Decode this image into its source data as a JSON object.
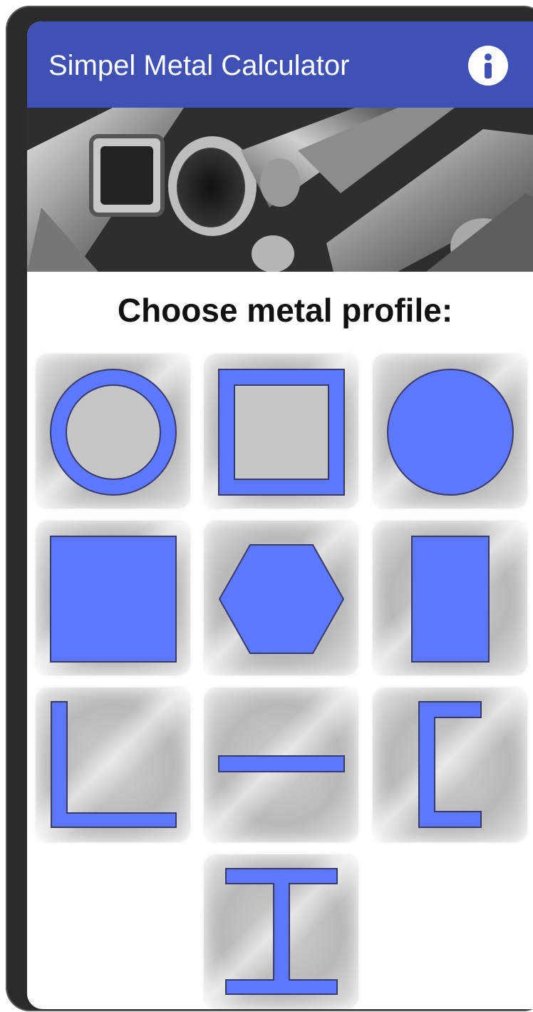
{
  "appbar": {
    "title": "Simpel Metal Calculator",
    "info_icon": "info-icon"
  },
  "hero": {
    "image": "metal-profiles-photo"
  },
  "main": {
    "heading": "Choose metal profile:",
    "profiles": [
      {
        "icon": "round-tube-icon"
      },
      {
        "icon": "square-tube-icon"
      },
      {
        "icon": "round-bar-icon"
      },
      {
        "icon": "square-bar-icon"
      },
      {
        "icon": "hexagon-bar-icon"
      },
      {
        "icon": "flat-bar-icon"
      },
      {
        "icon": "angle-profile-icon"
      },
      {
        "icon": "sheet-icon"
      },
      {
        "icon": "channel-profile-icon"
      },
      {
        "icon": "i-beam-icon"
      }
    ]
  },
  "colors": {
    "appbar": "#3f51b5",
    "profile_fill": "#5b78ff",
    "profile_stroke": "#3a3a6a"
  }
}
